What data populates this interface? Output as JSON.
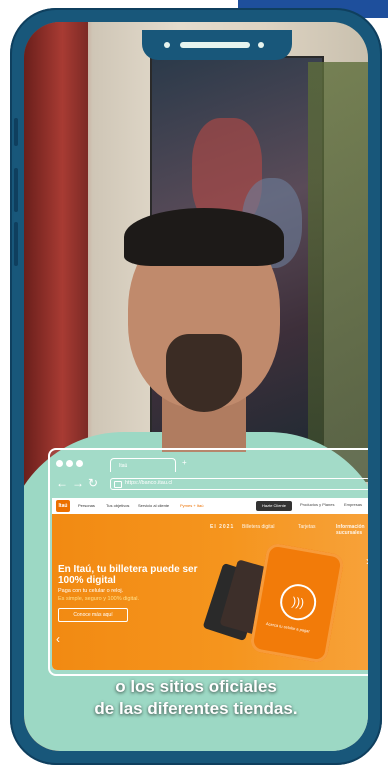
{
  "browser": {
    "tab_title": "Itaú",
    "url": "https://banco.itau.cl",
    "back_icon": "arrow-left-icon",
    "forward_icon": "arrow-right-icon",
    "reload_icon": "reload-icon"
  },
  "website": {
    "logo": "Itaú",
    "menu": [
      "Personas",
      "Tus objetivos",
      "Servicio al cliente",
      "Pymes + Itaú"
    ],
    "top_button": "Hazte Cliente",
    "top_links": [
      "Productos y Planes",
      "Empresas"
    ],
    "strip": [
      "El 2021",
      "Billetera digital",
      "Tarjetas",
      "Información sucursales"
    ],
    "hero_title": "En Itaú, tu billetera puede ser 100% digital",
    "hero_subtitle": "Paga con tu celular o reloj.",
    "hero_subtitle2": "Es simple, seguro y 100% digital.",
    "hero_button": "Conoce más aquí",
    "phone_caption": "Acerca tu celular a pagar"
  },
  "caption": {
    "line1": "o los sitios oficiales",
    "line2": "de las diferentes tiendas."
  },
  "colors": {
    "phone_frame": "#18577a",
    "accent_orange": "#f28a12",
    "brand_blue": "#1e4f9c"
  }
}
